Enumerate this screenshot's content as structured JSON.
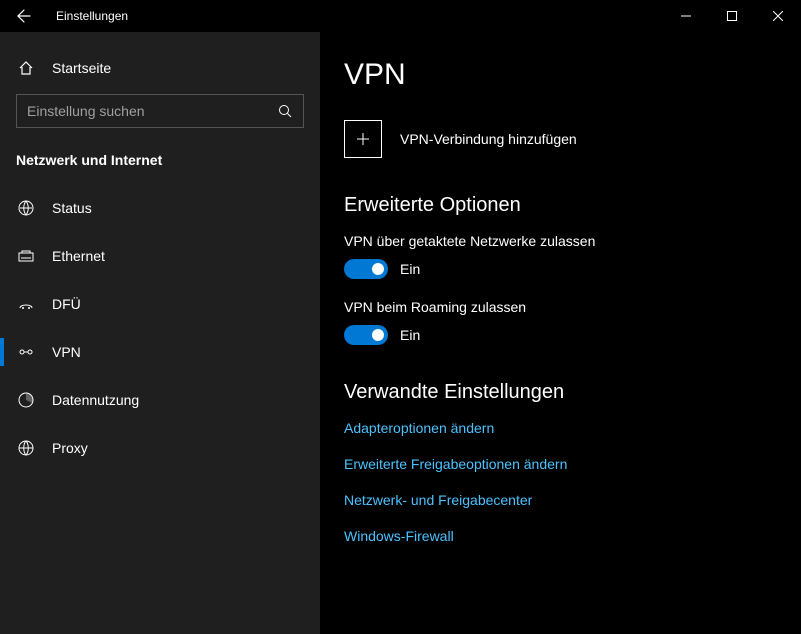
{
  "titlebar": {
    "title": "Einstellungen"
  },
  "sidebar": {
    "home_label": "Startseite",
    "search_placeholder": "Einstellung suchen",
    "category_label": "Netzwerk und Internet",
    "items": [
      {
        "label": "Status"
      },
      {
        "label": "Ethernet"
      },
      {
        "label": "DFÜ"
      },
      {
        "label": "VPN"
      },
      {
        "label": "Datennutzung"
      },
      {
        "label": "Proxy"
      }
    ]
  },
  "content": {
    "page_title": "VPN",
    "add_vpn_label": "VPN-Verbindung hinzufügen",
    "advanced_header": "Erweiterte Optionen",
    "toggle1_label": "VPN über getaktete Netzwerke zulassen",
    "toggle1_state": "Ein",
    "toggle2_label": "VPN beim Roaming zulassen",
    "toggle2_state": "Ein",
    "related_header": "Verwandte Einstellungen",
    "links": [
      "Adapteroptionen ändern",
      "Erweiterte Freigabeoptionen ändern",
      "Netzwerk- und Freigabecenter",
      "Windows-Firewall"
    ]
  }
}
